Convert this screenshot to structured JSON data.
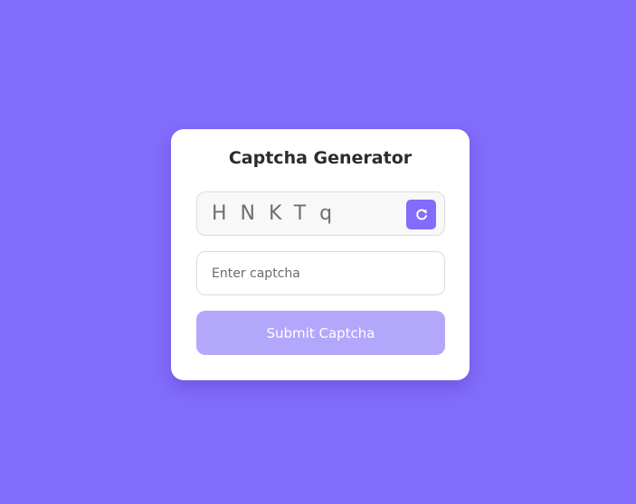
{
  "page": {
    "background_color": "#826cfc"
  },
  "card": {
    "title": "Captcha Generator"
  },
  "captcha": {
    "characters": "HNKTq",
    "refresh_icon": "refresh-icon",
    "accent_color": "#826cfc"
  },
  "input": {
    "value": "",
    "placeholder": "Enter captcha"
  },
  "submit": {
    "label": "Submit Captcha",
    "color": "#b3a7fc",
    "state": "disabled"
  }
}
